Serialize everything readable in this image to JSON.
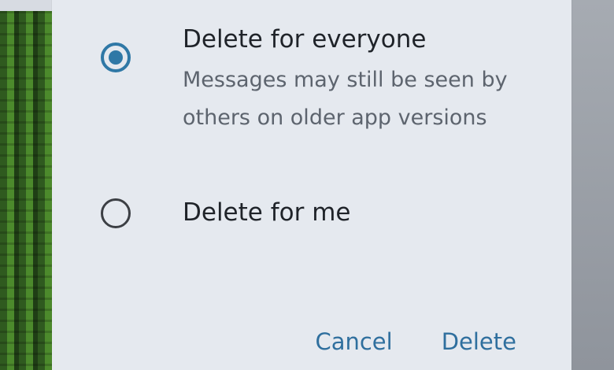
{
  "dialog": {
    "options": [
      {
        "label": "Delete for everyone",
        "description": "Messages may still be seen by others on older app versions",
        "selected": true
      },
      {
        "label": "Delete for me",
        "description": "",
        "selected": false
      }
    ],
    "buttons": {
      "cancel": "Cancel",
      "delete": "Delete"
    }
  },
  "colors": {
    "accent": "#2f78a6",
    "dialog_bg": "#e5e9ef",
    "text_primary": "#1f2329",
    "text_secondary": "#5d646e"
  }
}
